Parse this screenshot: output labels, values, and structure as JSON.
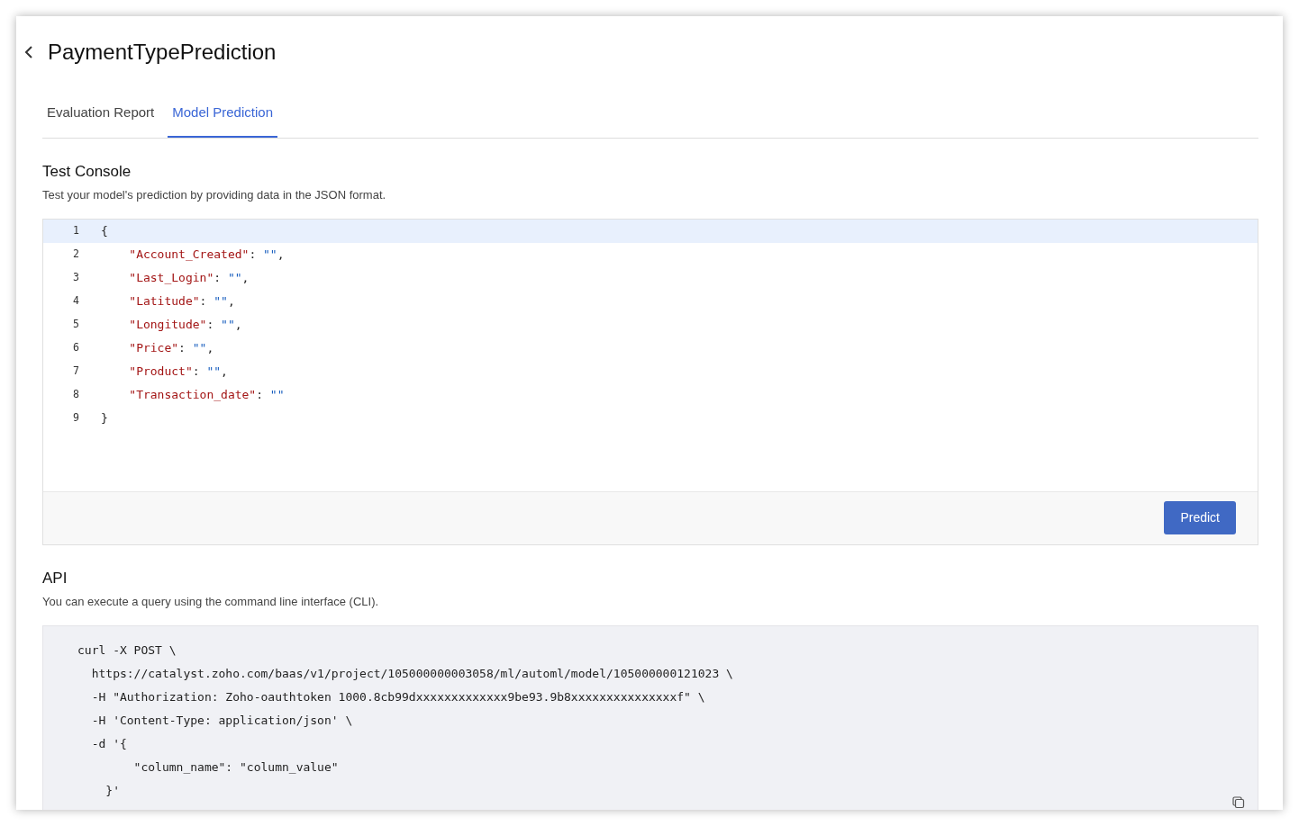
{
  "header": {
    "title": "PaymentTypePrediction"
  },
  "tabs": [
    {
      "label": "Evaluation Report",
      "selected": false
    },
    {
      "label": "Model Prediction",
      "selected": true
    }
  ],
  "test_console": {
    "title": "Test Console",
    "description": "Test your model's prediction by providing data in the JSON format.",
    "lines": [
      {
        "number": "1",
        "active": true,
        "tokens": [
          {
            "kind": "bracket",
            "text": "{"
          }
        ]
      },
      {
        "number": "2",
        "active": false,
        "tokens": [
          {
            "kind": "key",
            "text": "\"Account_Created\""
          },
          {
            "kind": "punct",
            "text": ": "
          },
          {
            "kind": "string",
            "text": "\"\""
          },
          {
            "kind": "punct",
            "text": ","
          }
        ]
      },
      {
        "number": "3",
        "active": false,
        "tokens": [
          {
            "kind": "key",
            "text": "\"Last_Login\""
          },
          {
            "kind": "punct",
            "text": ": "
          },
          {
            "kind": "string",
            "text": "\"\""
          },
          {
            "kind": "punct",
            "text": ","
          }
        ]
      },
      {
        "number": "4",
        "active": false,
        "tokens": [
          {
            "kind": "key",
            "text": "\"Latitude\""
          },
          {
            "kind": "punct",
            "text": ": "
          },
          {
            "kind": "string",
            "text": "\"\""
          },
          {
            "kind": "punct",
            "text": ","
          }
        ]
      },
      {
        "number": "5",
        "active": false,
        "tokens": [
          {
            "kind": "key",
            "text": "\"Longitude\""
          },
          {
            "kind": "punct",
            "text": ": "
          },
          {
            "kind": "string",
            "text": "\"\""
          },
          {
            "kind": "punct",
            "text": ","
          }
        ]
      },
      {
        "number": "6",
        "active": false,
        "tokens": [
          {
            "kind": "key",
            "text": "\"Price\""
          },
          {
            "kind": "punct",
            "text": ": "
          },
          {
            "kind": "string",
            "text": "\"\""
          },
          {
            "kind": "punct",
            "text": ","
          }
        ]
      },
      {
        "number": "7",
        "active": false,
        "tokens": [
          {
            "kind": "key",
            "text": "\"Product\""
          },
          {
            "kind": "punct",
            "text": ": "
          },
          {
            "kind": "string",
            "text": "\"\""
          },
          {
            "kind": "punct",
            "text": ","
          }
        ]
      },
      {
        "number": "8",
        "active": false,
        "tokens": [
          {
            "kind": "key",
            "text": "\"Transaction_date\""
          },
          {
            "kind": "punct",
            "text": ": "
          },
          {
            "kind": "string",
            "text": "\"\""
          }
        ]
      },
      {
        "number": "9",
        "active": false,
        "tokens": [
          {
            "kind": "bracket",
            "text": "}"
          }
        ]
      }
    ],
    "button": "Predict"
  },
  "api": {
    "title": "API",
    "description": "You can execute a query using the command line interface (CLI).",
    "code_lines": [
      "curl -X POST \\",
      "  https://catalyst.zoho.com/baas/v1/project/105000000003058/ml/automl/model/105000000121023 \\",
      "  -H \"Authorization: Zoho-oauthtoken 1000.8cb99dxxxxxxxxxxxxx9be93.9b8xxxxxxxxxxxxxxxf\" \\",
      "  -H 'Content-Type: application/json' \\",
      "  -d '{",
      "        \"column_name\": \"column_value\"",
      "    }'"
    ]
  }
}
